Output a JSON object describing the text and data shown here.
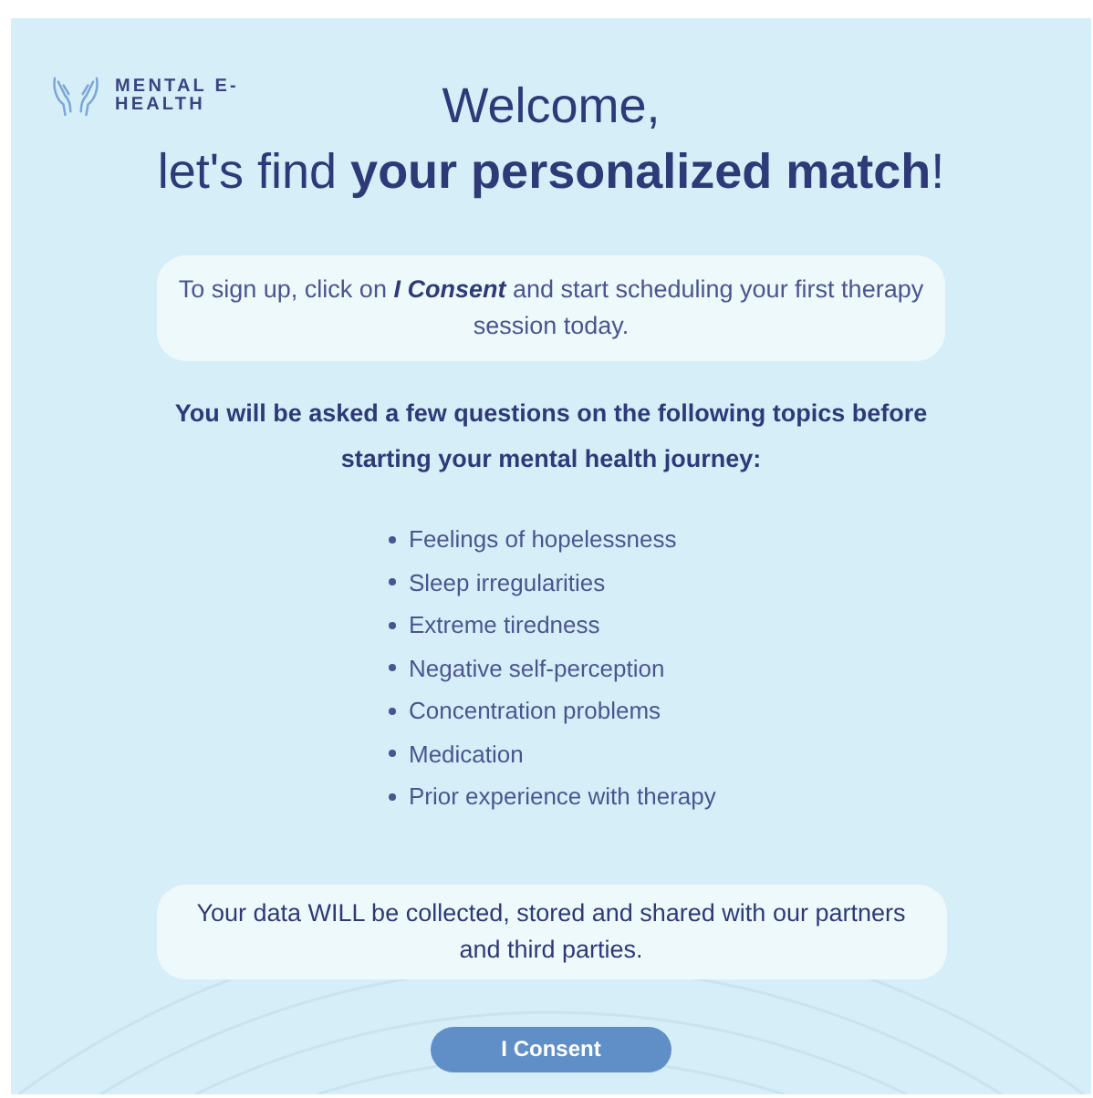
{
  "logo": {
    "text": "MENTAL E-\nHEALTH"
  },
  "heading": {
    "line_1": "Welcome,",
    "line_2": "let's find **your personalized match**!"
  },
  "intro": "To sign up, click on *I Consent* and start scheduling your first therapy session today.",
  "topics_intro": "You will be asked a few questions on the following topics before starting your mental health journey:",
  "topics": [
    "Feelings of hopelessness",
    "Sleep irregularities",
    "Extreme tiredness",
    "Negative self-perception",
    "Concentration problems",
    "Medication",
    "Prior experience with therapy"
  ],
  "data_notice": "Your data WILL be collected, stored and shared with our partners and third parties.",
  "buttons": [
    {
      "kind": "primary",
      "label": "I Consent"
    }
  ]
}
